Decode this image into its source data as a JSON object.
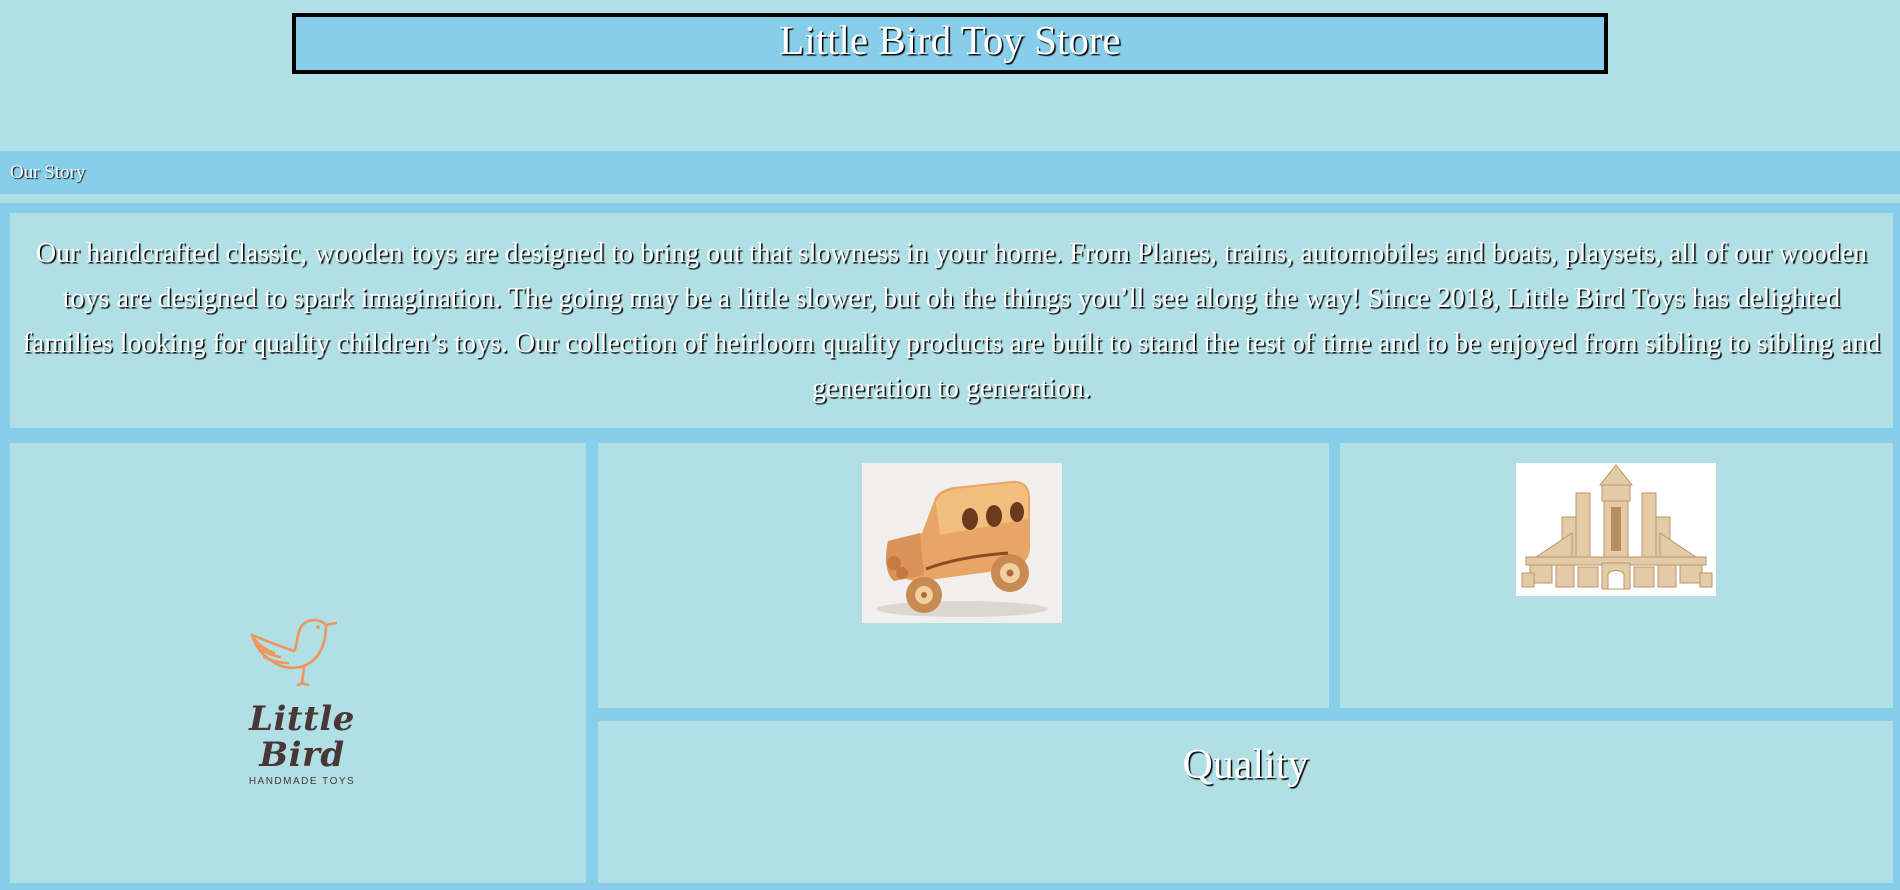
{
  "header": {
    "title": "Little Bird Toy Store"
  },
  "nav": {
    "items": [
      {
        "label": "Our Story"
      }
    ]
  },
  "story": {
    "text": "Our handcrafted classic, wooden toys are designed to bring out that slowness in your home. From Planes, trains, automobiles and boats, playsets, all of our wooden toys are designed to spark imagination. The going may be a little slower, but oh the things you’ll see along the way! Since 2018, Little Bird Toys has delighted families looking for quality children’s toys. Our collection of heirloom quality products are built to stand the test of time and to be enjoyed from sibling to sibling and generation to generation."
  },
  "logo": {
    "name": "Little Bird",
    "tagline": "HANDMADE TOYS"
  },
  "images": {
    "car": "wooden-toy-car-photo",
    "blocks": "wooden-blocks-castle-photo"
  },
  "quality": {
    "title": "Quality"
  },
  "colors": {
    "page_background": "#b0e0e6",
    "frame_blue": "#87ceeb",
    "text": "#ffffff",
    "text_shadow": "#000000",
    "header_border": "#000000",
    "logo_orange": "#f0955a",
    "logo_dark": "#4a3636"
  }
}
